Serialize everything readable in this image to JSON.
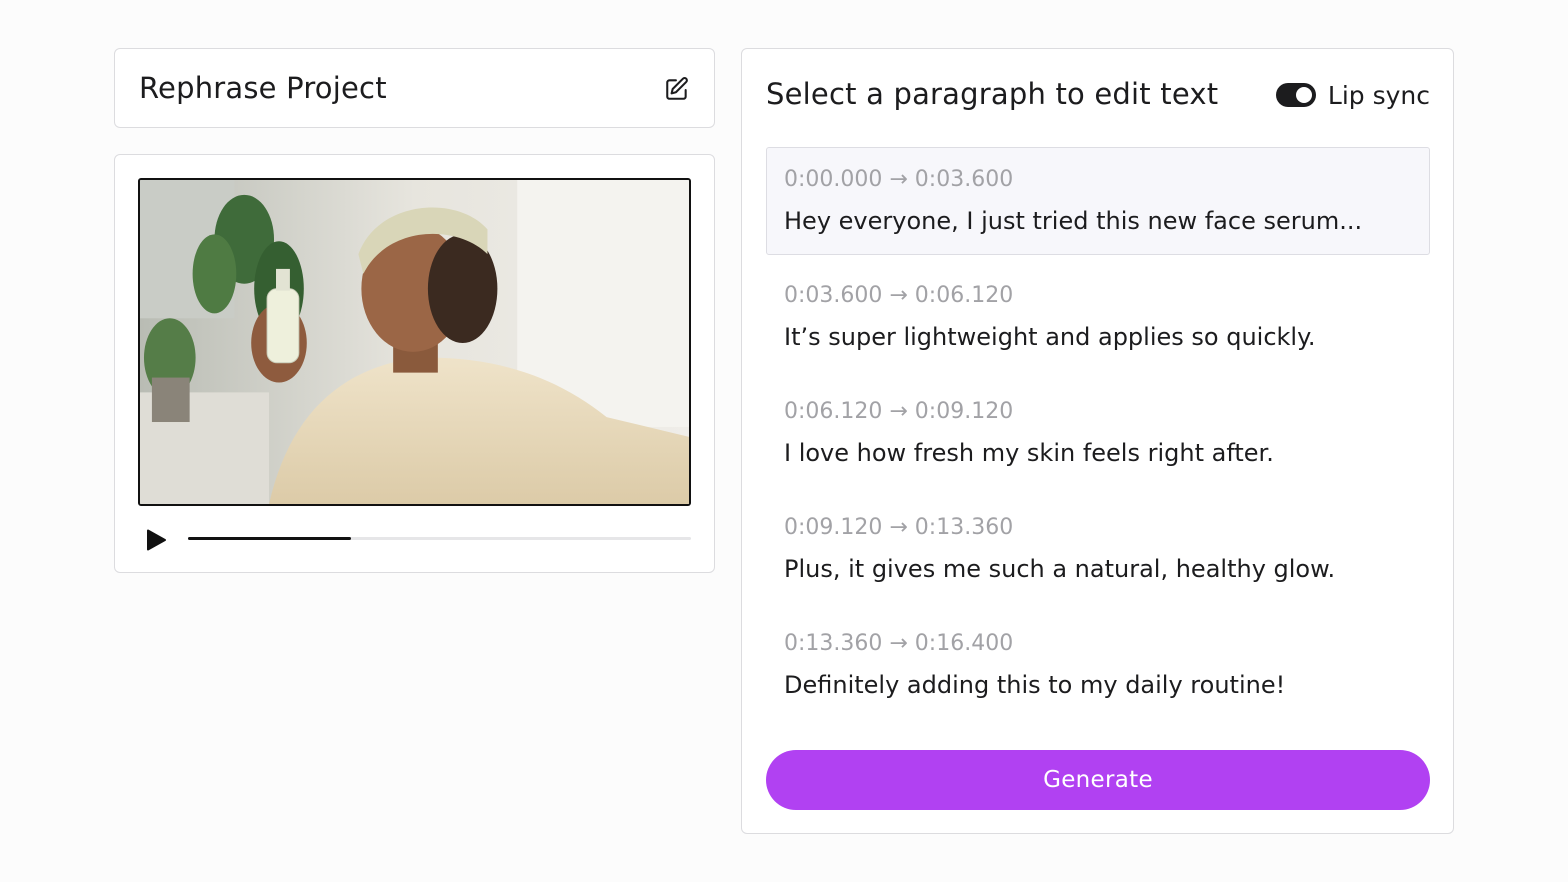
{
  "project": {
    "title": "Rephrase Project",
    "edit_icon": "edit-icon"
  },
  "player": {
    "play_icon": "play-icon",
    "progress": 0.325
  },
  "transcript": {
    "heading": "Select a paragraph to edit text",
    "lip_sync": {
      "label": "Lip sync",
      "enabled": true
    },
    "segments": [
      {
        "time": "0:00.000 → 0:03.600",
        "text": "Hey everyone, I just tried this new face serum...",
        "selected": true
      },
      {
        "time": "0:03.600 → 0:06.120",
        "text": "It’s super lightweight and applies so quickly.",
        "selected": false
      },
      {
        "time": "0:06.120 → 0:09.120",
        "text": "I love how fresh my skin feels right after.",
        "selected": false
      },
      {
        "time": "0:09.120 → 0:13.360",
        "text": "Plus, it gives me such a natural, healthy glow.",
        "selected": false
      },
      {
        "time": "0:13.360 → 0:16.400",
        "text": "Definitely adding this to my daily routine!",
        "selected": false
      }
    ],
    "generate_label": "Generate"
  },
  "colors": {
    "accent": "#b141f2",
    "selected_bg": "#f7f7fb",
    "timestamp": "#a2a2a6",
    "text": "#1c1c1e"
  }
}
